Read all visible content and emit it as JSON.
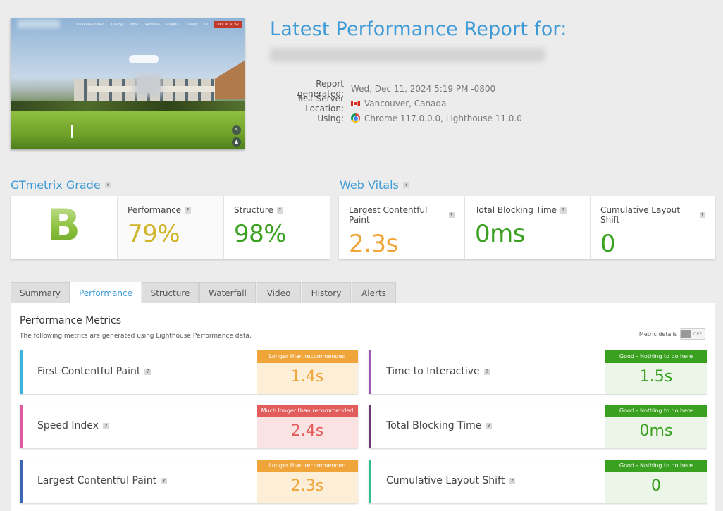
{
  "screenshot": {
    "nav": [
      "Accommodation",
      "Dining",
      "Offer",
      "Services",
      "Events",
      "Gallery",
      "VI"
    ],
    "book_now": "BOOK NOW"
  },
  "header": {
    "title": "Latest Performance Report for:",
    "meta": [
      {
        "label": "Report generated:",
        "value": "Wed, Dec 11, 2024 5:19 PM -0800"
      },
      {
        "label": "Test Server Location:",
        "value": "Vancouver, Canada"
      },
      {
        "label": "Using:",
        "value": "Chrome 117.0.0.0, Lighthouse 11.0.0"
      }
    ]
  },
  "grade": {
    "title": "GTmetrix Grade",
    "letter": "B",
    "performance_label": "Performance",
    "performance_value": "79%",
    "structure_label": "Structure",
    "structure_value": "98%"
  },
  "vitals": {
    "title": "Web Vitals",
    "items": [
      {
        "label": "Largest Contentful Paint",
        "value": "2.3s"
      },
      {
        "label": "Total Blocking Time",
        "value": "0ms"
      },
      {
        "label": "Cumulative Layout Shift",
        "value": "0"
      }
    ]
  },
  "tabs": [
    "Summary",
    "Performance",
    "Structure",
    "Waterfall",
    "Video",
    "History",
    "Alerts"
  ],
  "active_tab": "Performance",
  "panel": {
    "title": "Performance Metrics",
    "subtitle": "The following metrics are generated using Lighthouse Performance data.",
    "metric_details_label": "Metric details",
    "toggle_state": "OFF"
  },
  "metrics": [
    {
      "name": "First Contentful Paint",
      "badge": "Longer than recommended",
      "value": "1.4s",
      "status": "warn"
    },
    {
      "name": "Time to Interactive",
      "badge": "Good - Nothing to do here",
      "value": "1.5s",
      "status": "good"
    },
    {
      "name": "Speed Index",
      "badge": "Much longer than recommended",
      "value": "2.4s",
      "status": "bad"
    },
    {
      "name": "Total Blocking Time",
      "badge": "Good - Nothing to do here",
      "value": "0ms",
      "status": "good"
    },
    {
      "name": "Largest Contentful Paint",
      "badge": "Longer than recommended",
      "value": "2.3s",
      "status": "warn"
    },
    {
      "name": "Cumulative Layout Shift",
      "badge": "Good - Nothing to do here",
      "value": "0",
      "status": "good"
    }
  ],
  "colors": {
    "accent": "#3d9ad6",
    "performance": "#d0b42a",
    "good": "#3aa120",
    "warn": "#f0a53b",
    "bad": "#e25c5c",
    "fcp_border": "#3bb4d8",
    "tti_border": "#9b59b6",
    "si_border": "#e05aa0",
    "tbt_border": "#6c3b72",
    "lcp_border": "#3b66b0",
    "cls_border": "#2fbf8f"
  }
}
